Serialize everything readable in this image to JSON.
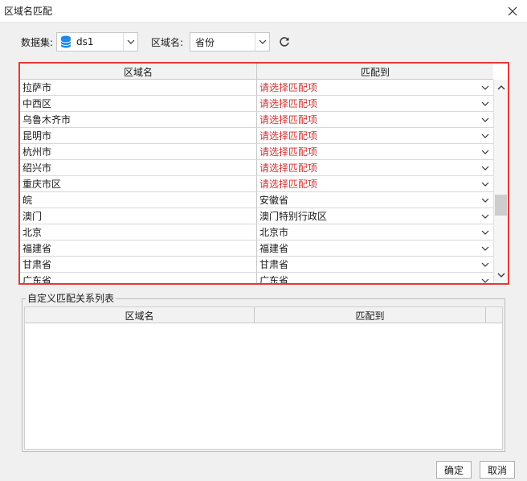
{
  "window": {
    "title": "区域名匹配"
  },
  "toolbar": {
    "dataset_label": "数据集:",
    "dataset_value": "ds1",
    "region_label": "区域名:",
    "region_value": "省份"
  },
  "grid": {
    "columns": [
      "区域名",
      "匹配到"
    ],
    "rows": [
      {
        "name": "拉萨市",
        "match": "请选择匹配项",
        "unset": true
      },
      {
        "name": "中西区",
        "match": "请选择匹配项",
        "unset": true
      },
      {
        "name": "乌鲁木齐市",
        "match": "请选择匹配项",
        "unset": true
      },
      {
        "name": "昆明市",
        "match": "请选择匹配项",
        "unset": true
      },
      {
        "name": "杭州市",
        "match": "请选择匹配项",
        "unset": true
      },
      {
        "name": "绍兴市",
        "match": "请选择匹配项",
        "unset": true
      },
      {
        "name": "重庆市区",
        "match": "请选择匹配项",
        "unset": true
      },
      {
        "name": "皖",
        "match": "安徽省",
        "unset": false
      },
      {
        "name": "澳门",
        "match": "澳门特别行政区",
        "unset": false
      },
      {
        "name": "北京",
        "match": "北京市",
        "unset": false
      },
      {
        "name": "福建省",
        "match": "福建省",
        "unset": false
      },
      {
        "name": "甘肃省",
        "match": "甘肃省",
        "unset": false
      },
      {
        "name": "广东省",
        "match": "广东省",
        "unset": false
      }
    ]
  },
  "custom": {
    "title": "自定义匹配关系列表",
    "columns": [
      "区域名",
      "匹配到"
    ]
  },
  "buttons": {
    "ok": "确定",
    "cancel": "取消"
  },
  "colors": {
    "highlight_border": "#e53935",
    "unset_text": "#d32f2f",
    "db_icon": "#1e88e5"
  }
}
